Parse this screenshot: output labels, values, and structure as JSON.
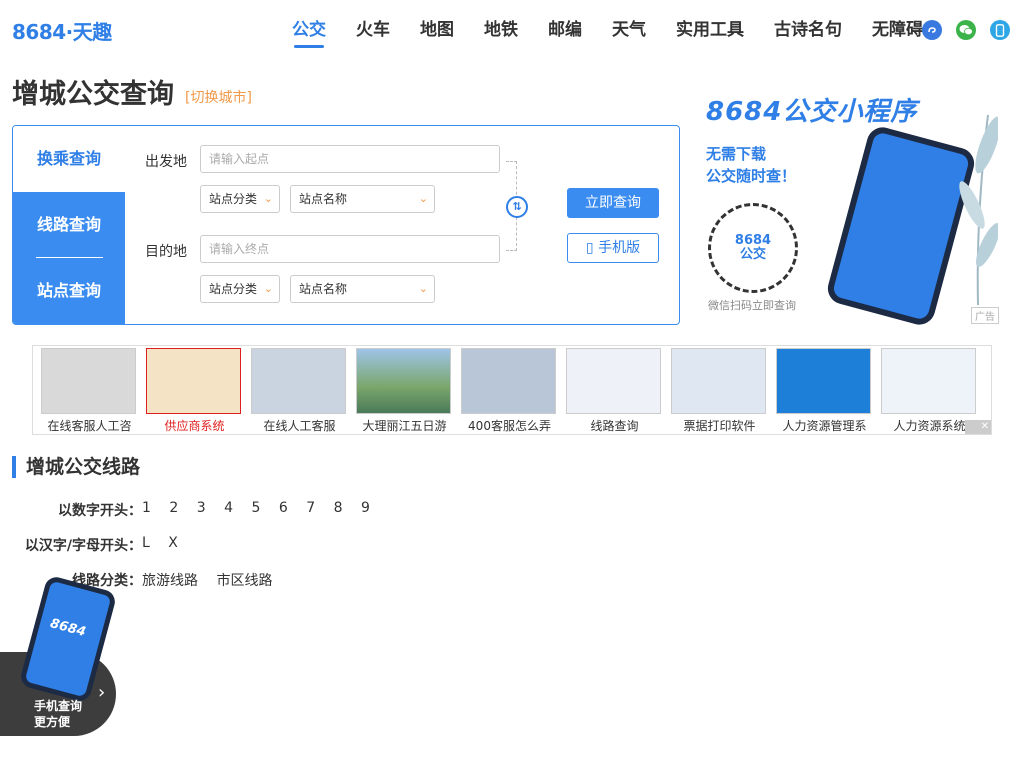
{
  "header": {
    "logo": "8684·天趣",
    "nav": [
      "公交",
      "火车",
      "地图",
      "地铁",
      "邮编",
      "天气",
      "实用工具",
      "古诗名句",
      "无障碍"
    ],
    "active_nav": "公交",
    "icons": [
      {
        "name": "mini-program-icon",
        "color": "#3a7ae0"
      },
      {
        "name": "wechat-icon",
        "color": "#3cb34a"
      },
      {
        "name": "mobile-icon",
        "color": "#2fa7e6"
      }
    ]
  },
  "title": {
    "city_title": "增城公交查询",
    "switch_city": "[切换城市]"
  },
  "search": {
    "tabs": [
      "换乘查询",
      "线路查询",
      "站点查询"
    ],
    "from_label": "出发地",
    "to_label": "目的地",
    "from_placeholder": "请输入起点",
    "to_placeholder": "请输入终点",
    "category_select": "站点分类",
    "name_select": "站点名称",
    "query_button": "立即查询",
    "mobile_button": "手机版"
  },
  "promo": {
    "title": "8684公交小程序",
    "subtitle_1": "无需下载",
    "subtitle_2": "公交随时查！",
    "qr_text_1": "8684",
    "qr_text_2": "公交",
    "caption": "微信扫码立即查询",
    "ad_badge": "广告"
  },
  "ads": [
    {
      "label": "在线客服人工咨",
      "color": "#d9d9d9",
      "highlight": false
    },
    {
      "label": "供应商系统",
      "color": "#f4e3c4",
      "highlight": true
    },
    {
      "label": "在线人工客服",
      "color": "#c9d4e0",
      "highlight": false
    },
    {
      "label": "大理丽江五日游",
      "color": "#7aa66a",
      "highlight": false
    },
    {
      "label": "400客服怎么弄",
      "color": "#b8c6d8",
      "highlight": false
    },
    {
      "label": "线路查询",
      "color": "#eef2f8",
      "highlight": false
    },
    {
      "label": "票据打印软件",
      "color": "#dfe8f2",
      "highlight": false
    },
    {
      "label": "人力资源管理系",
      "color": "#1e7fd8",
      "highlight": false
    },
    {
      "label": "人力资源系统",
      "color": "#eef3f9",
      "highlight": false
    }
  ],
  "ad_close": "✕",
  "lines": {
    "section_title": "增城公交线路",
    "digit_label": "以数字开头：",
    "digits": [
      "1",
      "2",
      "3",
      "4",
      "5",
      "6",
      "7",
      "8",
      "9"
    ],
    "letter_label": "以汉字/字母开头：",
    "letters": [
      "L",
      "X"
    ],
    "category_label": "线路分类：",
    "categories": [
      "旅游线路",
      "市区线路"
    ]
  },
  "float_banner": {
    "line1": "手机查询",
    "line2": "更方便",
    "phone_logo": "8684"
  },
  "colors": {
    "brand_blue": "#2f7fe6",
    "accent_orange": "#f09a4a",
    "highlight_red": "#e02020"
  }
}
